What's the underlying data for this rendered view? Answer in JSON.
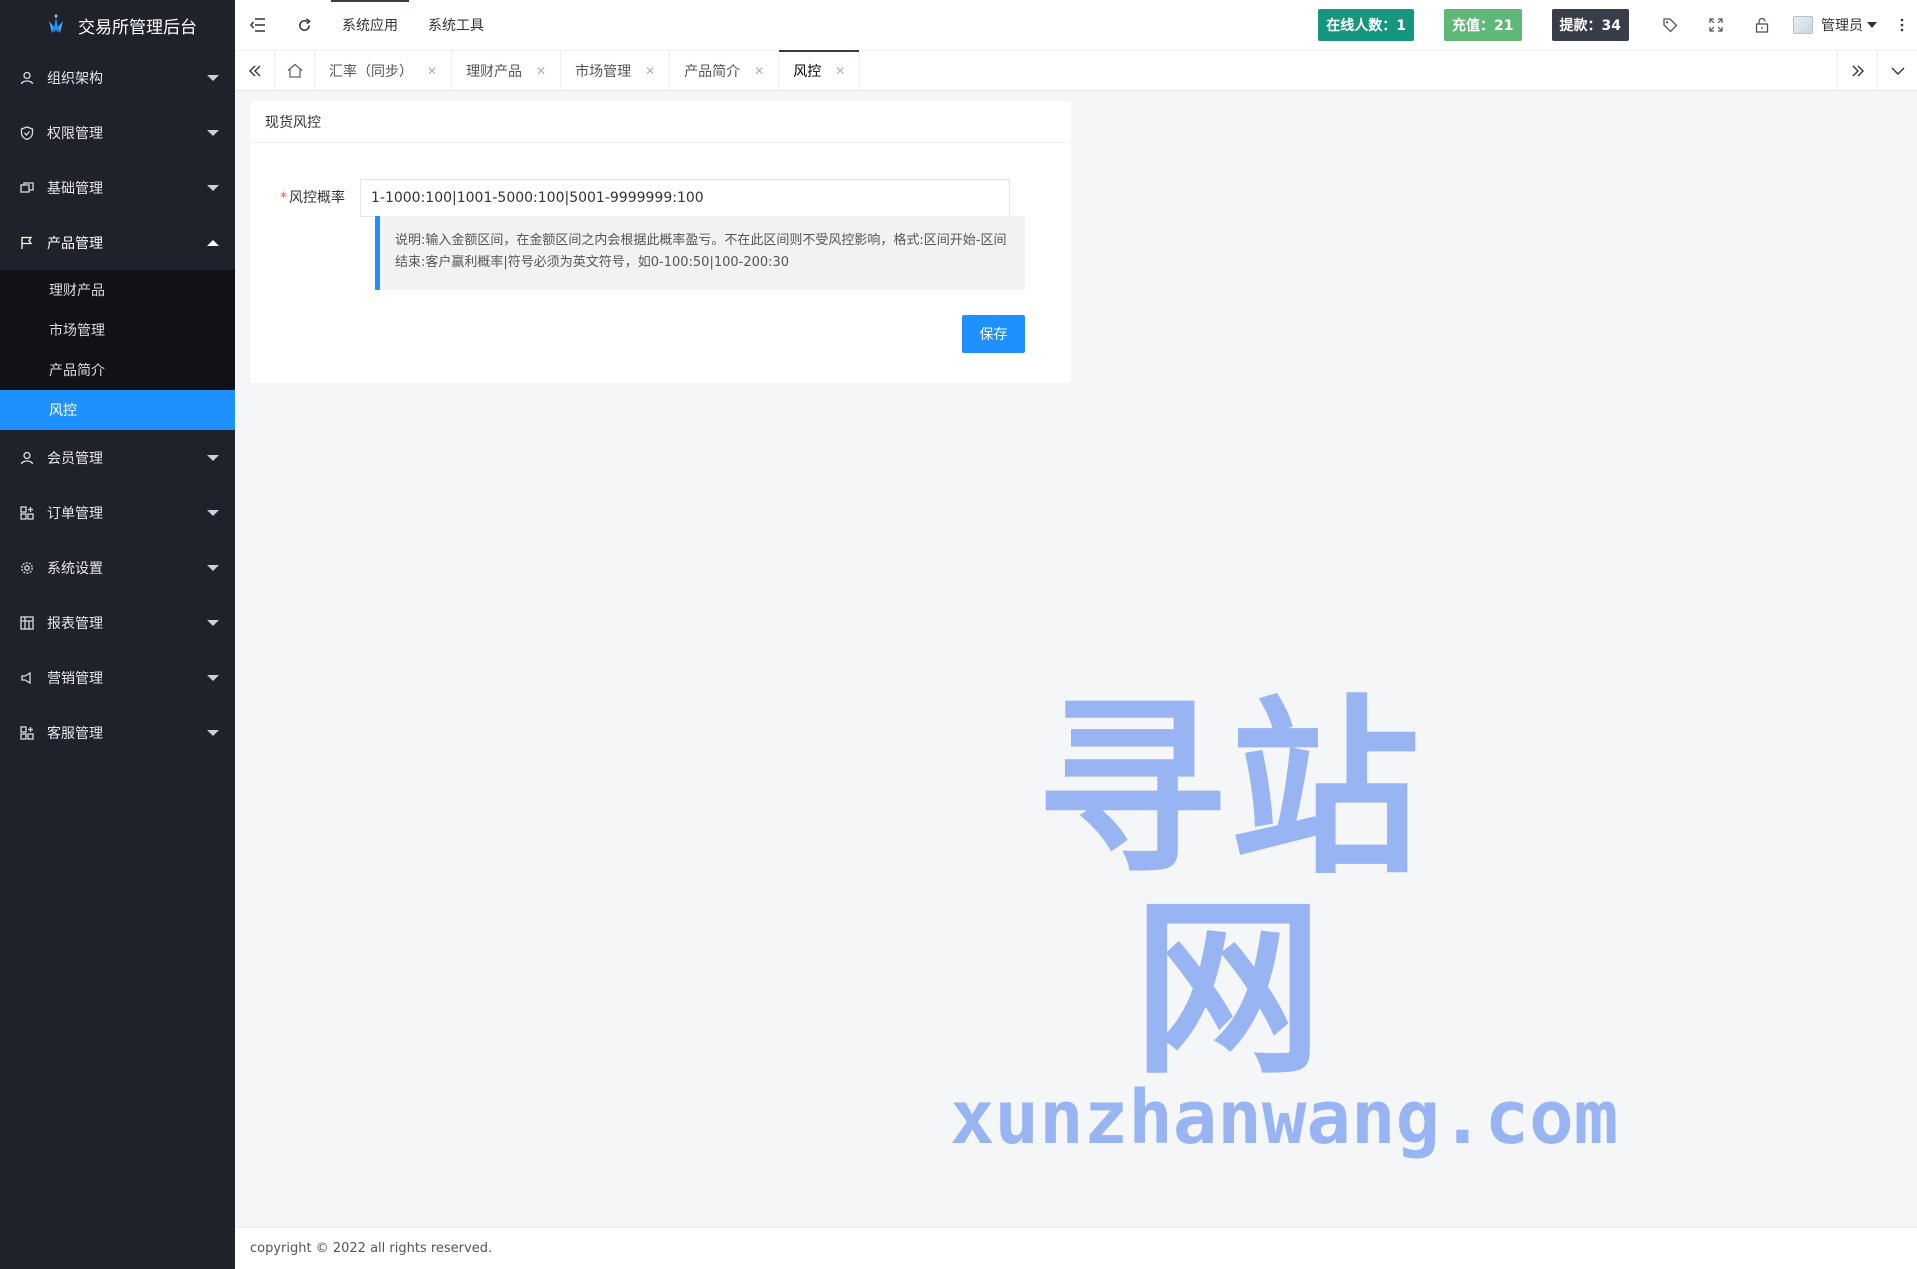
{
  "app": {
    "title": "交易所管理后台"
  },
  "header": {
    "nav": [
      "系统应用",
      "系统工具"
    ],
    "badges": {
      "online": "在线人数：1",
      "recharge": "充值：21",
      "withdraw": "提款：34"
    },
    "user": "管理员"
  },
  "sidebar": {
    "items": [
      {
        "label": "组织架构",
        "icon": "user-icon"
      },
      {
        "label": "权限管理",
        "icon": "shield-icon"
      },
      {
        "label": "基础管理",
        "icon": "cards-icon"
      },
      {
        "label": "产品管理",
        "icon": "flag-icon"
      },
      {
        "label": "会员管理",
        "icon": "user-icon"
      },
      {
        "label": "订单管理",
        "icon": "grid-icon"
      },
      {
        "label": "系统设置",
        "icon": "gear-icon"
      },
      {
        "label": "报表管理",
        "icon": "table-icon"
      },
      {
        "label": "营销管理",
        "icon": "megaphone-icon"
      },
      {
        "label": "客服管理",
        "icon": "grid-icon"
      }
    ],
    "submenu": [
      "理财产品",
      "市场管理",
      "产品简介",
      "风控"
    ]
  },
  "tabs": [
    {
      "label": "汇率（同步）",
      "active": false
    },
    {
      "label": "理财产品",
      "active": false
    },
    {
      "label": "市场管理",
      "active": false
    },
    {
      "label": "产品简介",
      "active": false
    },
    {
      "label": "风控",
      "active": true
    }
  ],
  "card": {
    "title": "现货风控",
    "field_label": "风控概率",
    "field_value": "1-1000:100|1001-5000:100|5001-9999999:100",
    "note": "说明:输入金额区间，在金额区间之内会根据此概率盈亏。不在此区间则不受风控影响，格式:区间开始-区间结束:客户赢利概率|符号必须为英文符号，如0-100:50|100-200:30",
    "save": "保存"
  },
  "watermark": {
    "cn": "寻站网",
    "en": "xunzhanwang.com"
  },
  "footer": {
    "text": "copyright © 2022 all rights reserved."
  },
  "colors": {
    "accent": "#1e90ff",
    "sidebar": "#20222b",
    "online": "#16957f",
    "recharge": "#5fb878",
    "withdraw": "#393d49"
  }
}
